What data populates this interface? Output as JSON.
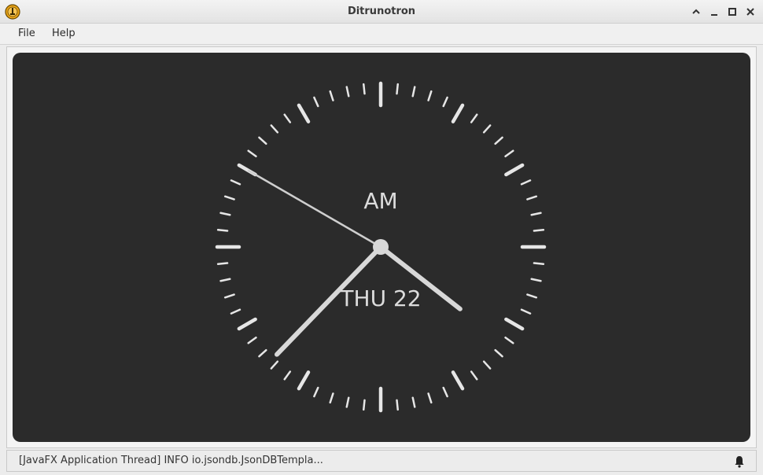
{
  "window": {
    "title": "Ditrunotron",
    "controls": [
      "minimize-up",
      "minimize",
      "maximize",
      "close"
    ]
  },
  "menu": {
    "file_label": "File",
    "help_label": "Help"
  },
  "clock": {
    "period": "AM",
    "date": "THU 22",
    "hour_hand_deg": 128,
    "minute_hand_deg": 224,
    "second_hand_deg": 300,
    "colors": {
      "face_bg": "#2b2b2b",
      "ticks": "#e6e6e6",
      "hands": "#d8d8d8",
      "second_hand": "#cfcfcf",
      "text": "#dcdcdc"
    }
  },
  "status": {
    "message": "[JavaFX Application Thread] INFO io.jsondb.JsonDBTempla...",
    "icon": "bell-icon"
  }
}
